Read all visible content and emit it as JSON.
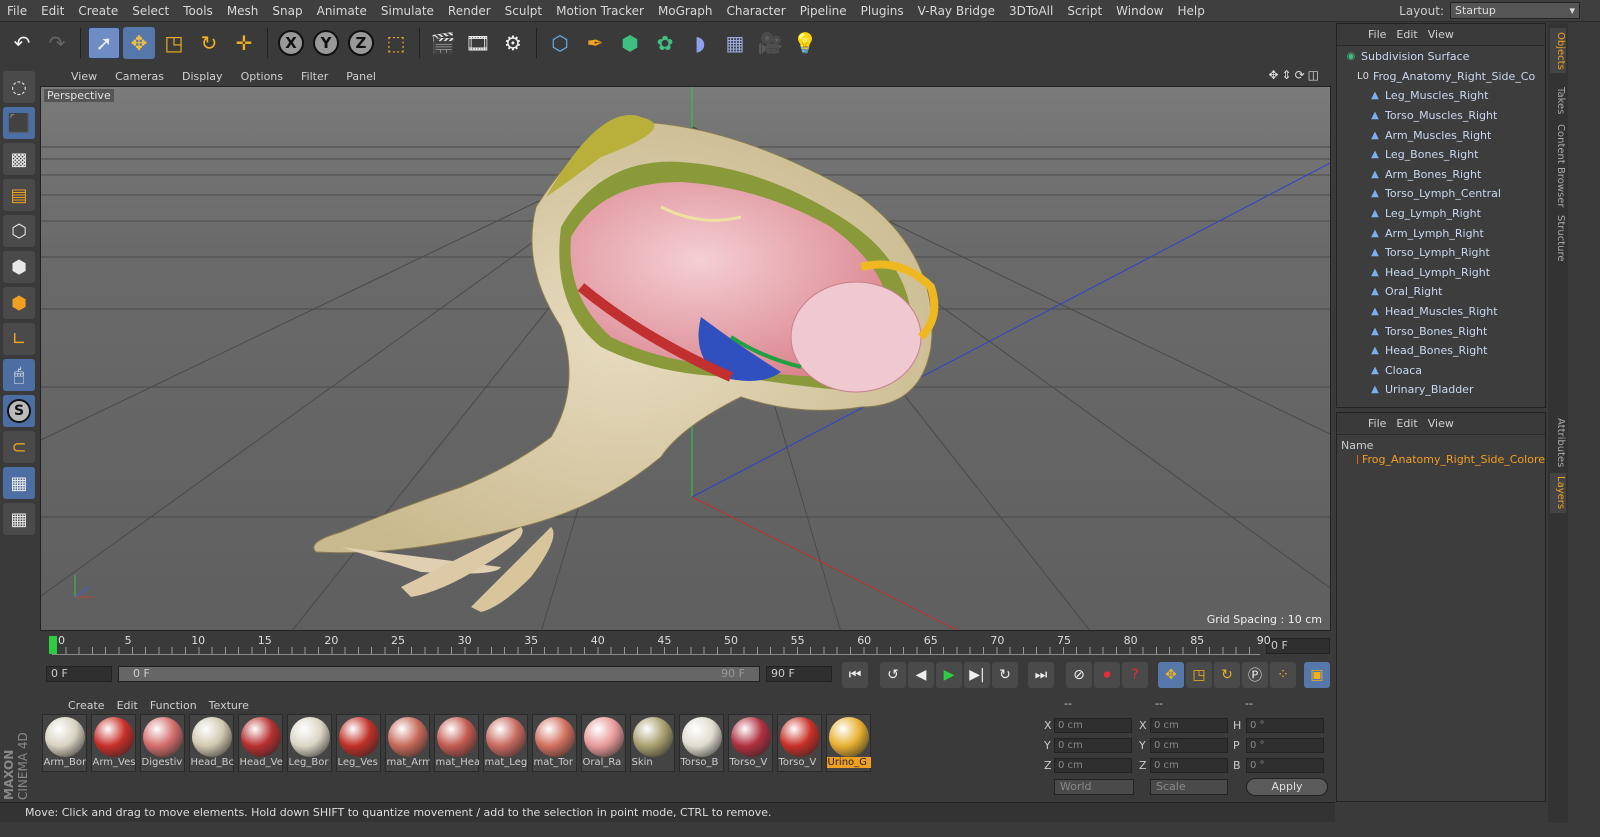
{
  "menubar": {
    "items": [
      "File",
      "Edit",
      "Create",
      "Select",
      "Tools",
      "Mesh",
      "Snap",
      "Animate",
      "Simulate",
      "Render",
      "Sculpt",
      "Motion Tracker",
      "MoGraph",
      "Character",
      "Pipeline",
      "Plugins",
      "V-Ray Bridge",
      "3DToAll",
      "Script",
      "Window",
      "Help"
    ],
    "layout_label": "Layout:",
    "layout_value": "Startup"
  },
  "toolbar": {
    "icons": [
      "undo-icon",
      "redo-icon",
      "live-select-icon",
      "move-icon",
      "scale-icon",
      "rotate-icon",
      "add-icon",
      "x-axis-icon",
      "y-axis-icon",
      "z-axis-icon",
      "coordinate-system-icon",
      "render-view-icon",
      "render-picture-viewer-icon",
      "edit-render-settings-icon",
      "cube-icon",
      "pen-icon",
      "subdivision-icon",
      "array-icon",
      "deformer-icon",
      "floor-icon",
      "camera-icon",
      "light-icon"
    ],
    "axis_x": "X",
    "axis_y": "Y",
    "axis_z": "Z"
  },
  "leftbar": {
    "icons": [
      "make-editable-icon",
      "model-mode-icon",
      "texture-mode-icon",
      "workplane-icon",
      "points-mode-icon",
      "edges-mode-icon",
      "polygons-mode-icon",
      "axis-mode-icon",
      "tweak-mode-icon",
      "solo-icon",
      "snap-icon",
      "workplane-lock-icon",
      "planar-workplane-icon"
    ],
    "solo_label": "S"
  },
  "viewport": {
    "menu": [
      "View",
      "Cameras",
      "Display",
      "Options",
      "Filter",
      "Panel"
    ],
    "label": "Perspective",
    "grid_spacing": "Grid Spacing : 10 cm"
  },
  "timeline": {
    "ticks": [
      "0",
      "5",
      "10",
      "15",
      "20",
      "25",
      "30",
      "35",
      "40",
      "45",
      "50",
      "55",
      "60",
      "65",
      "70",
      "75",
      "80",
      "85",
      "90"
    ],
    "end_frame": "0 F",
    "current_frame": "0 F",
    "slider_start": "0 F",
    "slider_end": "90 F",
    "max_frame": "90 F"
  },
  "materials": {
    "menu": [
      "Create",
      "Edit",
      "Function",
      "Texture"
    ],
    "items": [
      {
        "label": "Arm_Bor",
        "color": "#d8d2c0"
      },
      {
        "label": "Arm_Ves",
        "color": "#c8302a"
      },
      {
        "label": "Digestiv",
        "color": "#d46d6d"
      },
      {
        "label": "Head_Bc",
        "color": "#d0c8b0"
      },
      {
        "label": "Head_Ve",
        "color": "#b83030"
      },
      {
        "label": "Leg_Bor",
        "color": "#dcd6c6"
      },
      {
        "label": "Leg_Ves",
        "color": "#c03028"
      },
      {
        "label": "mat_Arm",
        "color": "#c76a5a"
      },
      {
        "label": "mat_Hea",
        "color": "#c45a50"
      },
      {
        "label": "mat_Leg",
        "color": "#c86a60"
      },
      {
        "label": "mat_Tor",
        "color": "#d27060"
      },
      {
        "label": "Oral_Ra",
        "color": "#e89a9a"
      },
      {
        "label": "Skin",
        "color": "#a8a070"
      },
      {
        "label": "Torso_B",
        "color": "#e0dcd0"
      },
      {
        "label": "Torso_V",
        "color": "#b03040"
      },
      {
        "label": "Torso_V",
        "color": "#c83028"
      },
      {
        "label": "Urino_G",
        "color": "#e8b030"
      }
    ],
    "selected_index": 16
  },
  "coords": {
    "header_dashes": [
      "--",
      "--",
      "--"
    ],
    "rows": [
      {
        "l1": "X",
        "v1": "0 cm",
        "l2": "X",
        "v2": "0 cm",
        "l3": "H",
        "v3": "0 °"
      },
      {
        "l1": "Y",
        "v1": "0 cm",
        "l2": "Y",
        "v2": "0 cm",
        "l3": "P",
        "v3": "0 °"
      },
      {
        "l1": "Z",
        "v1": "0 cm",
        "l2": "Z",
        "v2": "0 cm",
        "l3": "B",
        "v3": "0 °"
      }
    ],
    "space": "World",
    "mode": "Scale",
    "apply": "Apply"
  },
  "status": "Move: Click and drag to move elements. Hold down SHIFT to quantize movement / add to the selection in point mode, CTRL to remove.",
  "brand": {
    "line1": "MAXON",
    "line2": "CINEMA 4D"
  },
  "objects": {
    "menu": [
      "File",
      "Edit",
      "View"
    ],
    "items": [
      {
        "label": "Subdivision Surface",
        "depth": 0,
        "kind": "sub"
      },
      {
        "label": "Frog_Anatomy_Right_Side_Co",
        "depth": 1,
        "kind": "null"
      },
      {
        "label": "Leg_Muscles_Right",
        "depth": 2,
        "kind": "poly"
      },
      {
        "label": "Torso_Muscles_Right",
        "depth": 2,
        "kind": "poly"
      },
      {
        "label": "Arm_Muscles_Right",
        "depth": 2,
        "kind": "poly"
      },
      {
        "label": "Leg_Bones_Right",
        "depth": 2,
        "kind": "poly"
      },
      {
        "label": "Arm_Bones_Right",
        "depth": 2,
        "kind": "poly"
      },
      {
        "label": "Torso_Lymph_Central",
        "depth": 2,
        "kind": "poly"
      },
      {
        "label": "Leg_Lymph_Right",
        "depth": 2,
        "kind": "poly"
      },
      {
        "label": "Arm_Lymph_Right",
        "depth": 2,
        "kind": "poly"
      },
      {
        "label": "Torso_Lymph_Right",
        "depth": 2,
        "kind": "poly"
      },
      {
        "label": "Head_Lymph_Right",
        "depth": 2,
        "kind": "poly"
      },
      {
        "label": "Oral_Right",
        "depth": 2,
        "kind": "poly"
      },
      {
        "label": "Head_Muscles_Right",
        "depth": 2,
        "kind": "poly"
      },
      {
        "label": "Torso_Bones_Right",
        "depth": 2,
        "kind": "poly"
      },
      {
        "label": "Head_Bones_Right",
        "depth": 2,
        "kind": "poly"
      },
      {
        "label": "Cloaca",
        "depth": 2,
        "kind": "poly"
      },
      {
        "label": "Urinary_Bladder",
        "depth": 2,
        "kind": "poly"
      }
    ]
  },
  "layers": {
    "menu": [
      "File",
      "Edit",
      "View"
    ],
    "column": "Name",
    "item": "Frog_Anatomy_Right_Side_Colore"
  },
  "sidetabs": [
    "Objects",
    "Takes",
    "Content Browser",
    "Structure",
    "Attributes",
    "Layers"
  ]
}
